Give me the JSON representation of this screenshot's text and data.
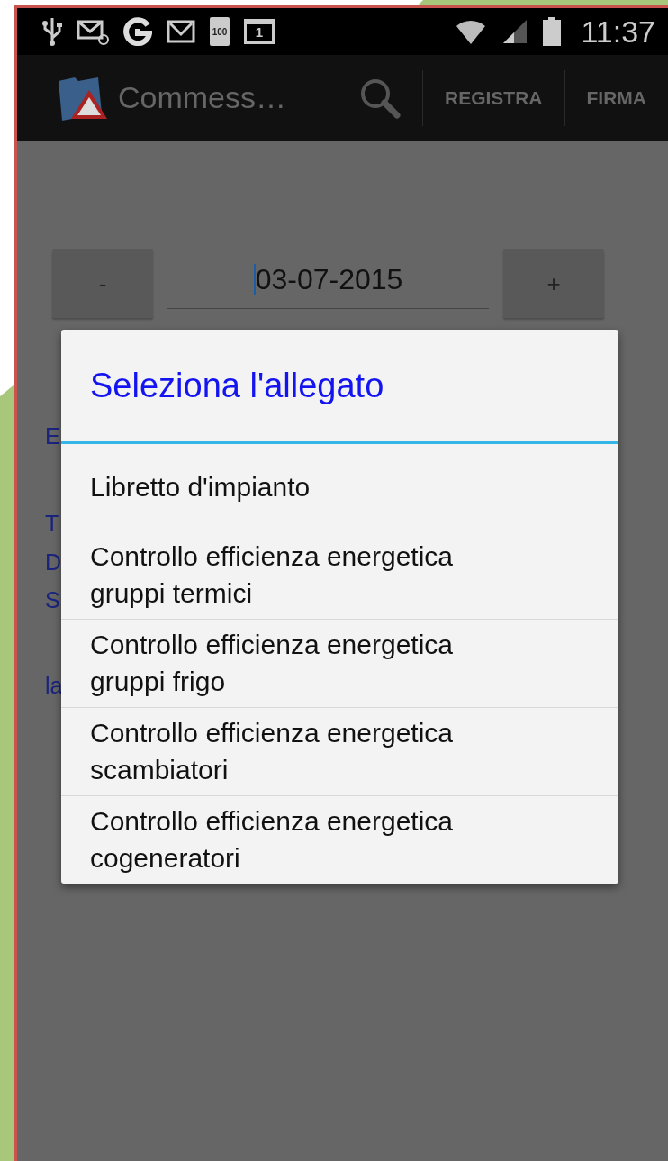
{
  "status_bar": {
    "battery_icon_label": "100",
    "calendar_day": "1",
    "time": "11:37"
  },
  "action_bar": {
    "title": "Commess…",
    "actions": [
      {
        "label": "REGISTRA"
      },
      {
        "label": "FIRMA"
      }
    ]
  },
  "date_stepper": {
    "decrement": "-",
    "value": "03-07-2015",
    "increment": "+"
  },
  "background_fragments": [
    "E",
    "T",
    "D",
    "S",
    "la"
  ],
  "dialog": {
    "title": "Seleziona l'allegato",
    "items": [
      {
        "label": "Libretto d'impianto"
      },
      {
        "label": "Controllo efficienza energetica\ngruppi termici"
      },
      {
        "label": "Controllo efficienza energetica\ngruppi frigo"
      },
      {
        "label": "Controllo efficienza energetica\nscambiatori"
      },
      {
        "label": "Controllo efficienza energetica\ncogeneratori"
      }
    ]
  }
}
